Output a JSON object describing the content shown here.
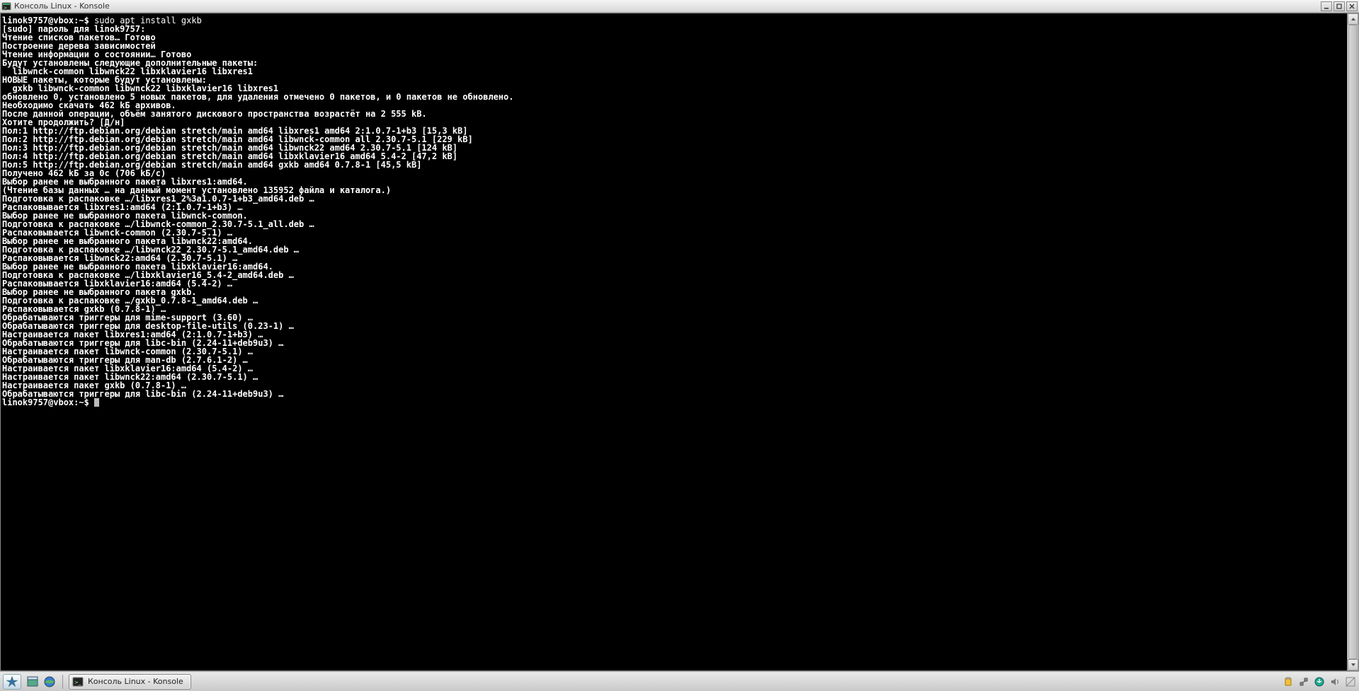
{
  "window": {
    "title": "Консоль Linux - Konsole"
  },
  "terminal": {
    "prompt1_user": "linok9757@vbox",
    "prompt1_sep": ":",
    "prompt1_path": "~",
    "prompt1_dollar": "$ ",
    "cmd1": "sudo apt install gxkb",
    "lines": [
      "[sudo] пароль для linok9757:",
      "Чтение списков пакетов… Готово",
      "Построение дерева зависимостей",
      "Чтение информации о состоянии… Готово",
      "Будут установлены следующие дополнительные пакеты:",
      "  libwnck-common libwnck22 libxklavier16 libxres1",
      "НОВЫЕ пакеты, которые будут установлены:",
      "  gxkb libwnck-common libwnck22 libxklavier16 libxres1",
      "обновлено 0, установлено 5 новых пакетов, для удаления отмечено 0 пакетов, и 0 пакетов не обновлено.",
      "Необходимо скачать 462 kБ архивов.",
      "После данной операции, объём занятого дискового пространства возрастёт на 2 555 kB.",
      "Хотите продолжить? [Д/н]",
      "Пол:1 http://ftp.debian.org/debian stretch/main amd64 libxres1 amd64 2:1.0.7-1+b3 [15,3 kB]",
      "Пол:2 http://ftp.debian.org/debian stretch/main amd64 libwnck-common all 2.30.7-5.1 [229 kB]",
      "Пол:3 http://ftp.debian.org/debian stretch/main amd64 libwnck22 amd64 2.30.7-5.1 [124 kB]",
      "Пол:4 http://ftp.debian.org/debian stretch/main amd64 libxklavier16 amd64 5.4-2 [47,2 kB]",
      "Пол:5 http://ftp.debian.org/debian stretch/main amd64 gxkb amd64 0.7.8-1 [45,5 kB]",
      "Получено 462 kБ за 0с (706 kБ/c)",
      "Выбор ранее не выбранного пакета libxres1:amd64.",
      "(Чтение базы данных … на данный момент установлено 135952 файла и каталога.)",
      "Подготовка к распаковке …/libxres1_2%3a1.0.7-1+b3_amd64.deb …",
      "Распаковывается libxres1:amd64 (2:1.0.7-1+b3) …",
      "Выбор ранее не выбранного пакета libwnck-common.",
      "Подготовка к распаковке …/libwnck-common_2.30.7-5.1_all.deb …",
      "Распаковывается libwnck-common (2.30.7-5.1) …",
      "Выбор ранее не выбранного пакета libwnck22:amd64.",
      "Подготовка к распаковке …/libwnck22_2.30.7-5.1_amd64.deb …",
      "Распаковывается libwnck22:amd64 (2.30.7-5.1) …",
      "Выбор ранее не выбранного пакета libxklavier16:amd64.",
      "Подготовка к распаковке …/libxklavier16_5.4-2_amd64.deb …",
      "Распаковывается libxklavier16:amd64 (5.4-2) …",
      "Выбор ранее не выбранного пакета gxkb.",
      "Подготовка к распаковке …/gxkb_0.7.8-1_amd64.deb …",
      "Распаковывается gxkb (0.7.8-1) …",
      "Обрабатываются триггеры для mime-support (3.60) …",
      "Обрабатываются триггеры для desktop-file-utils (0.23-1) …",
      "Настраивается пакет libxres1:amd64 (2:1.0.7-1+b3) …",
      "Обрабатываются триггеры для libc-bin (2.24-11+deb9u3) …",
      "Настраивается пакет libwnck-common (2.30.7-5.1) …",
      "Обрабатываются триггеры для man-db (2.7.6.1-2) …",
      "Настраивается пакет libxklavier16:amd64 (5.4-2) …",
      "Настраивается пакет libwnck22:amd64 (2.30.7-5.1) …",
      "Настраивается пакет gxkb (0.7.8-1) …",
      "Обрабатываются триггеры для libc-bin (2.24-11+deb9u3) …"
    ],
    "prompt2_user": "linok9757@vbox",
    "prompt2_sep": ":",
    "prompt2_path": "~",
    "prompt2_dollar": "$ "
  },
  "taskbar": {
    "task_label": "Консоль Linux - Konsole"
  }
}
